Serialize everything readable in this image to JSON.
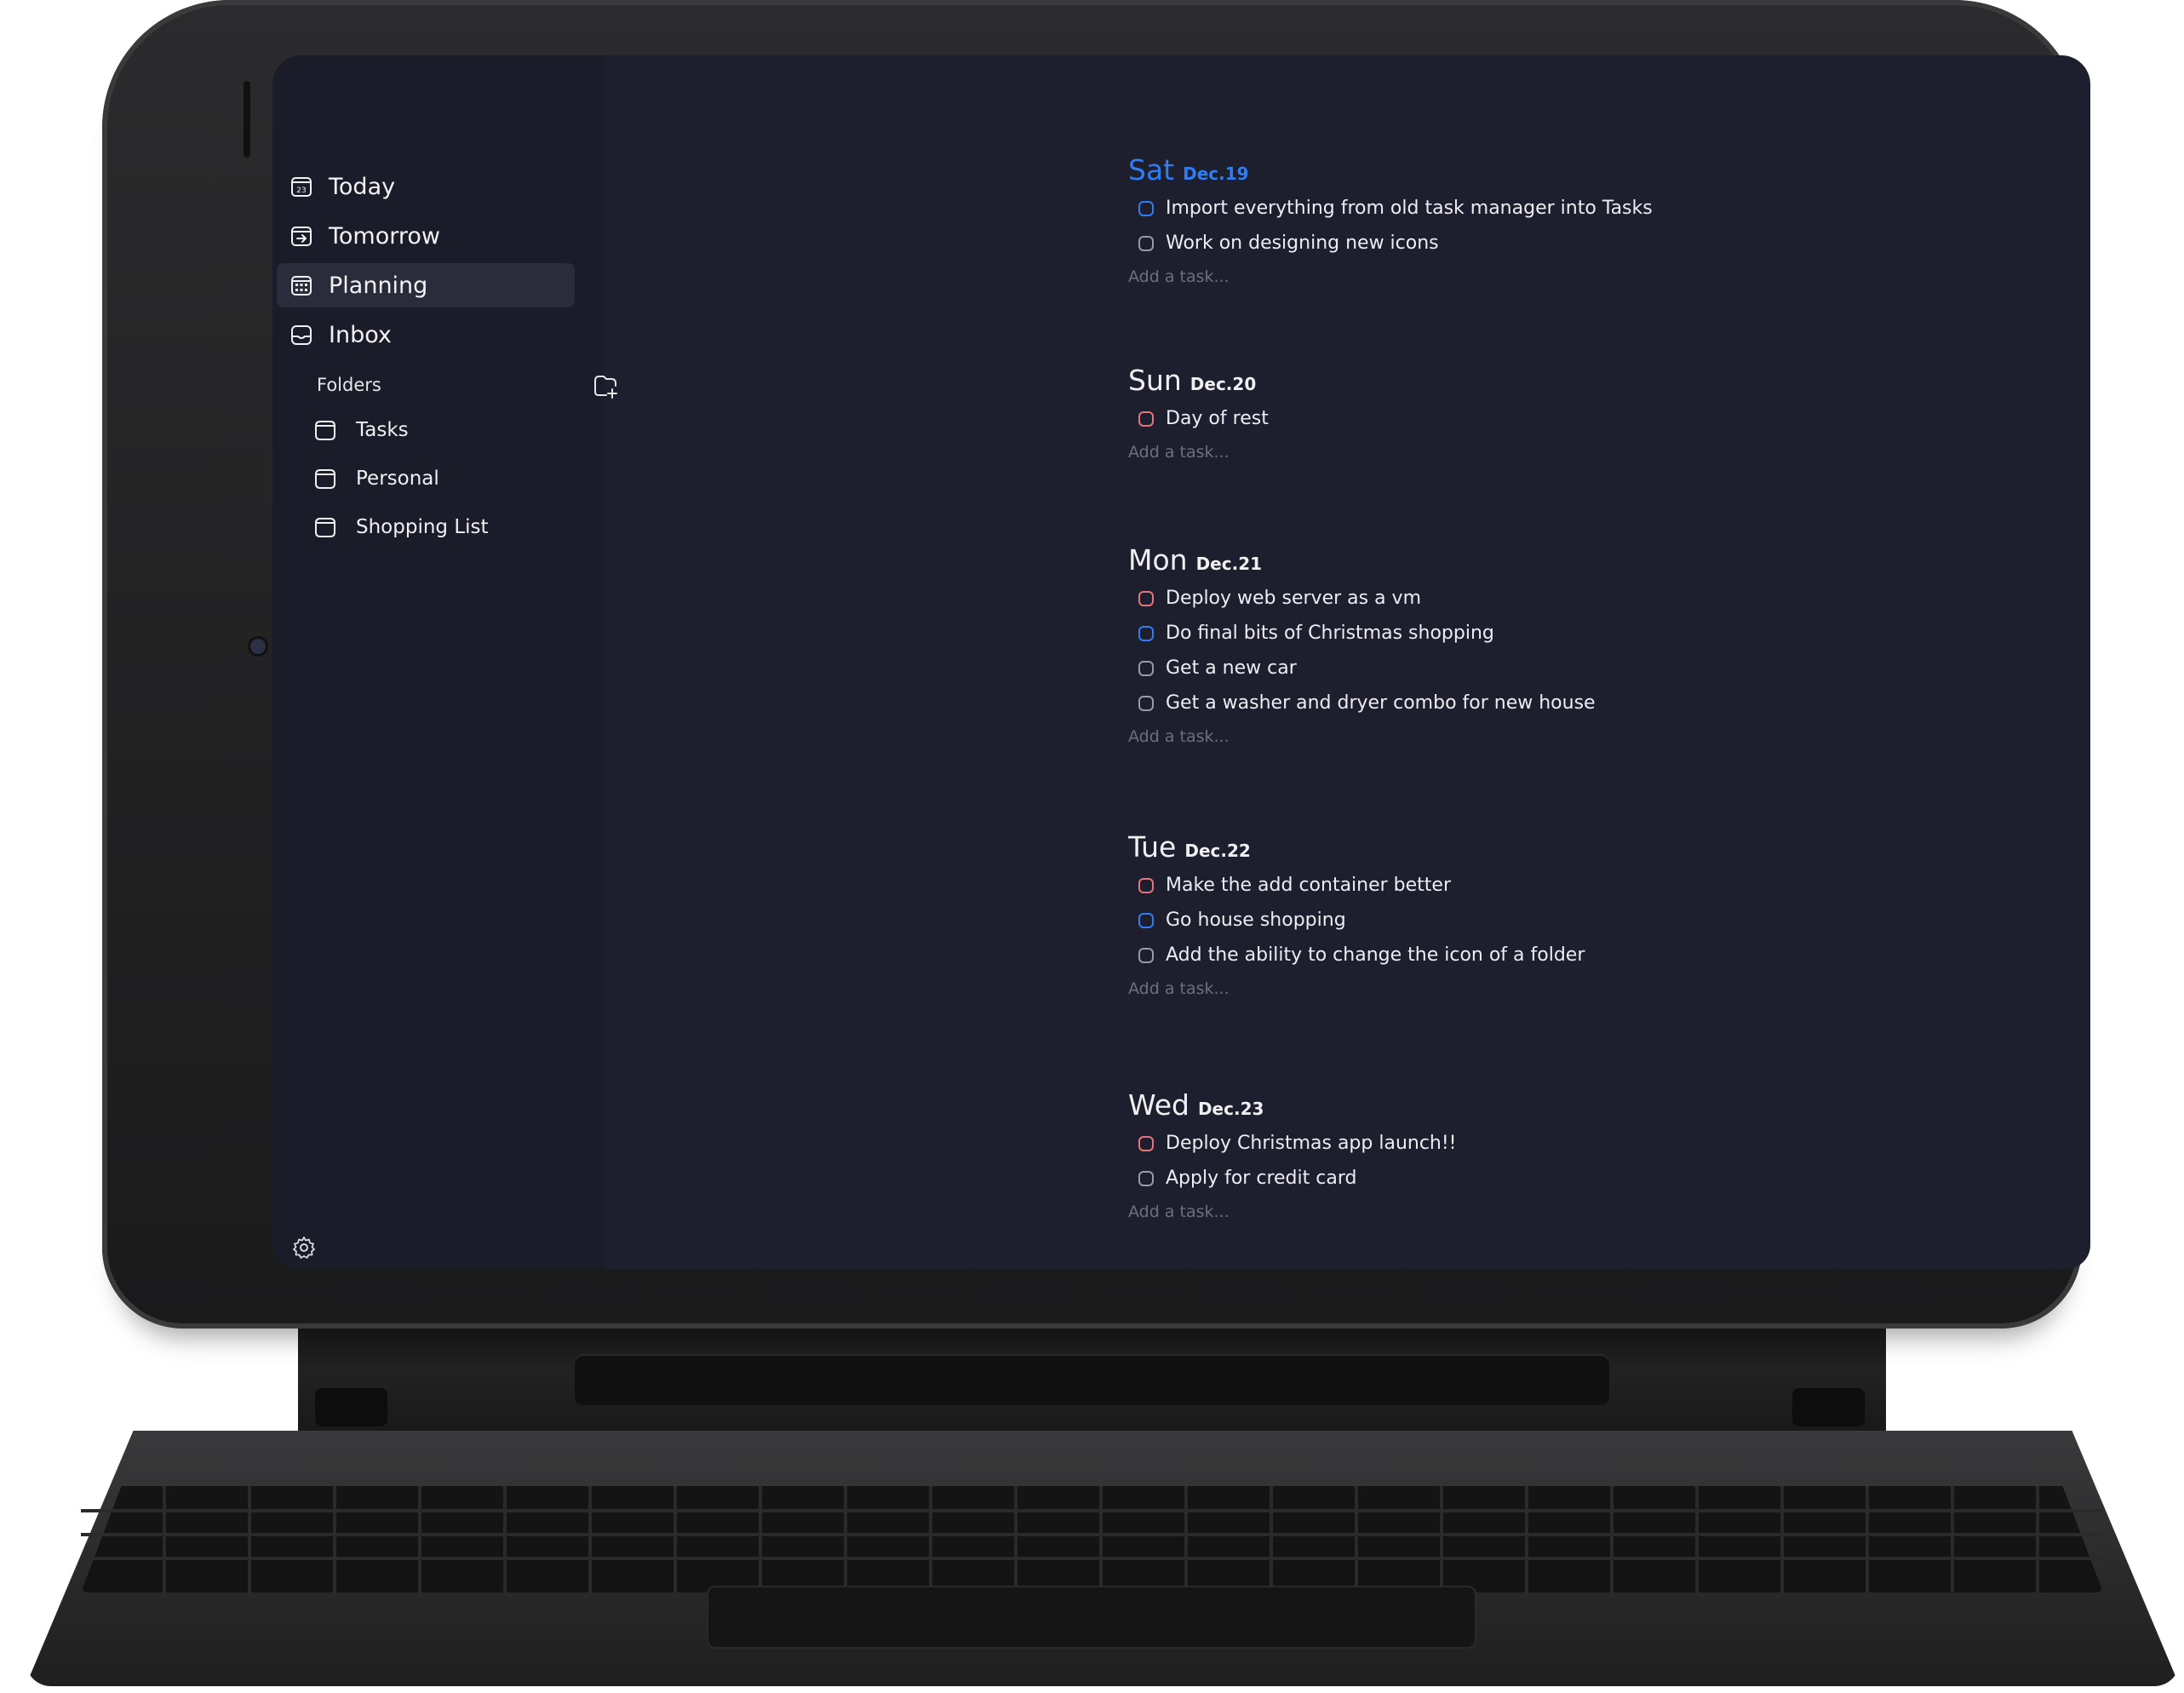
{
  "sidebar": {
    "nav": [
      {
        "label": "Today",
        "icon": "calendar-today-icon"
      },
      {
        "label": "Tomorrow",
        "icon": "calendar-arrow-icon"
      },
      {
        "label": "Planning",
        "icon": "calendar-grid-icon",
        "active": true
      },
      {
        "label": "Inbox",
        "icon": "inbox-icon"
      }
    ],
    "today_icon_text": "23",
    "folders_header": "Folders",
    "folders": [
      {
        "label": "Tasks"
      },
      {
        "label": "Personal"
      },
      {
        "label": "Shopping List"
      }
    ]
  },
  "planning": {
    "add_task_placeholder": "Add a task...",
    "days": [
      {
        "name": "Sat",
        "date": "Dec.19",
        "highlight": true,
        "tasks": [
          {
            "text": "Import everything from old task manager into Tasks",
            "priority": "blue"
          },
          {
            "text": "Work on designing new icons",
            "priority": "gray"
          }
        ]
      },
      {
        "name": "Sun",
        "date": "Dec.20",
        "tasks": [
          {
            "text": "Day of rest",
            "priority": "red"
          }
        ]
      },
      {
        "name": "Mon",
        "date": "Dec.21",
        "tasks": [
          {
            "text": "Deploy web server as a vm",
            "priority": "red"
          },
          {
            "text": "Do final bits of Christmas shopping",
            "priority": "blue"
          },
          {
            "text": "Get a new car",
            "priority": "gray"
          },
          {
            "text": "Get a washer and dryer combo for new house",
            "priority": "gray"
          }
        ]
      },
      {
        "name": "Tue",
        "date": "Dec.22",
        "tasks": [
          {
            "text": "Make the add container better",
            "priority": "red"
          },
          {
            "text": "Go house shopping",
            "priority": "blue"
          },
          {
            "text": "Add the ability to change the icon of a folder",
            "priority": "gray"
          }
        ]
      },
      {
        "name": "Wed",
        "date": "Dec.23",
        "tasks": [
          {
            "text": "Deploy Christmas app launch!!",
            "priority": "red"
          },
          {
            "text": "Apply for credit card",
            "priority": "gray"
          }
        ]
      }
    ]
  },
  "colors": {
    "background": "#1e1f2e",
    "sidebar": "#1b1c29",
    "accent_blue": "#2f7df6",
    "priority_red": "#e8747a",
    "priority_gray": "#9a9aa2"
  }
}
